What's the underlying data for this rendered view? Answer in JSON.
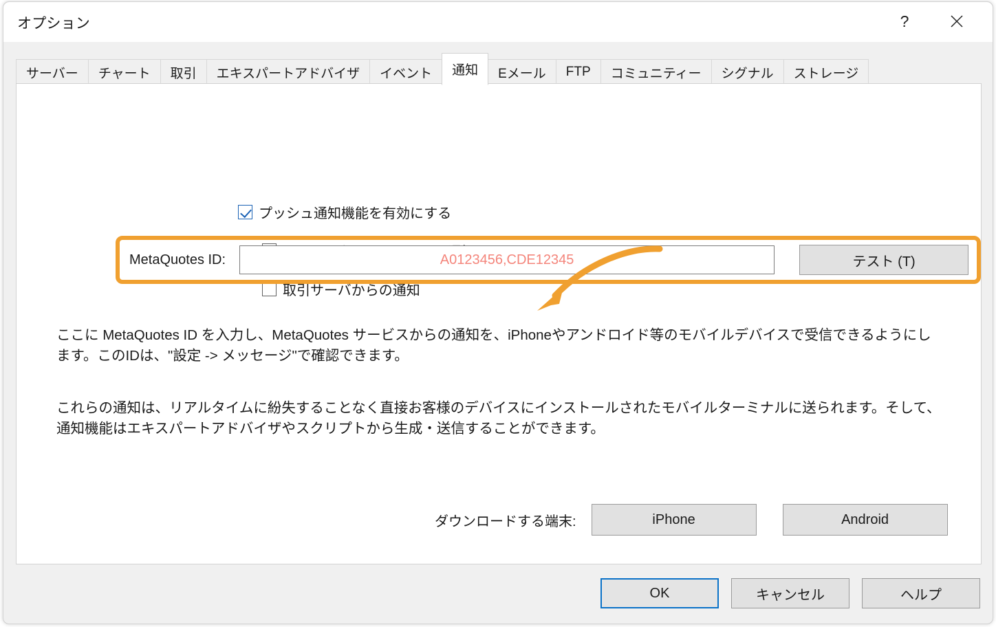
{
  "window": {
    "title": "オプション",
    "help_icon": "question-mark-icon",
    "close_icon": "close-icon"
  },
  "tabs": [
    {
      "label": "サーバー",
      "selected": false
    },
    {
      "label": "チャート",
      "selected": false
    },
    {
      "label": "取引",
      "selected": false
    },
    {
      "label": "エキスパートアドバイザ",
      "selected": false
    },
    {
      "label": "イベント",
      "selected": false
    },
    {
      "label": "通知",
      "selected": true
    },
    {
      "label": "Eメール",
      "selected": false
    },
    {
      "label": "FTP",
      "selected": false
    },
    {
      "label": "コミュニティー",
      "selected": false
    },
    {
      "label": "シグナル",
      "selected": false
    },
    {
      "label": "ストレージ",
      "selected": false
    }
  ],
  "notifications": {
    "enable_push": {
      "label": "プッシュ通知機能を有効にする",
      "checked": true
    },
    "local_terminal": {
      "label": "ローカルターミナルからの通知",
      "checked": false
    },
    "trade_server": {
      "label": "取引サーバからの通知",
      "checked": false
    },
    "metaquotes": {
      "label": "MetaQuotes ID:",
      "value": "A0123456,CDE12345",
      "placeholder": "A0123456,CDE12345",
      "test_button": "テスト (T)"
    },
    "paragraph_1": "ここに MetaQuotes ID を入力し、MetaQuotes サービスからの通知を、iPhoneやアンドロイド等のモバイルデバイスで受信できるようにします。このIDは、\"設定 -> メッセージ\"で確認できます。",
    "paragraph_2": "これらの通知は、リアルタイムに紛失することなく直接お客様のデバイスにインストールされたモバイルターミナルに送られます。そして、通知機能はエキスパートアドバイザやスクリプトから生成・送信することができます。",
    "download": {
      "label": "ダウンロードする端末:",
      "iphone": "iPhone",
      "android": "Android"
    }
  },
  "footer": {
    "ok": "OK",
    "cancel": "キャンセル",
    "help": "ヘルプ"
  },
  "annotation": {
    "highlight_color": "#F0A030",
    "arrow": "curved-arrow-icon",
    "value_text_color": "#F4857B",
    "accent_blue": "#0A72C8"
  }
}
